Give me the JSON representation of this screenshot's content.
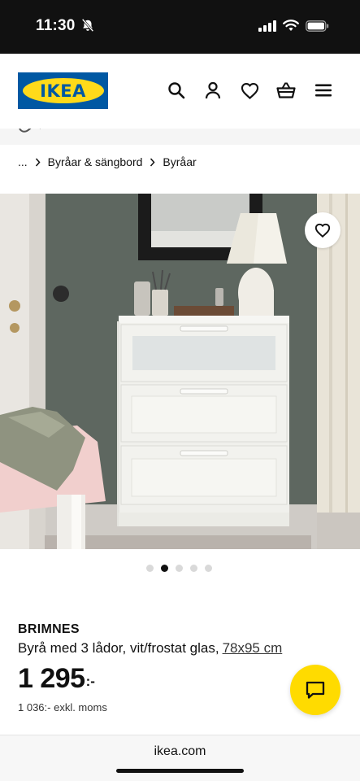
{
  "status_bar": {
    "time": "11:30"
  },
  "header": {
    "logo_text": "IKEA"
  },
  "breadcrumb": {
    "ellipsis": "...",
    "items": [
      "Byråar & sängbord",
      "Byråar"
    ]
  },
  "hero": {
    "image_count": 5,
    "active_index": 1
  },
  "product": {
    "name": "BRIMNES",
    "description": "Byrå med 3 lådor, vit/frostat glas,",
    "size": "78x95 cm",
    "price": "1 295",
    "price_suffix": ":-",
    "price_ex_vat": "1 036:- exkl. moms"
  },
  "browser": {
    "url": "ikea.com"
  },
  "colors": {
    "ikea_blue": "#0058a3",
    "ikea_yellow": "#ffda1a",
    "chat_yellow": "#ffdb00"
  },
  "icons": [
    "bell-off-icon",
    "signal-icon",
    "wifi-icon",
    "battery-icon",
    "search-icon",
    "profile-icon",
    "heart-icon",
    "basket-icon",
    "menu-icon",
    "chevron-right-icon",
    "chat-icon"
  ]
}
